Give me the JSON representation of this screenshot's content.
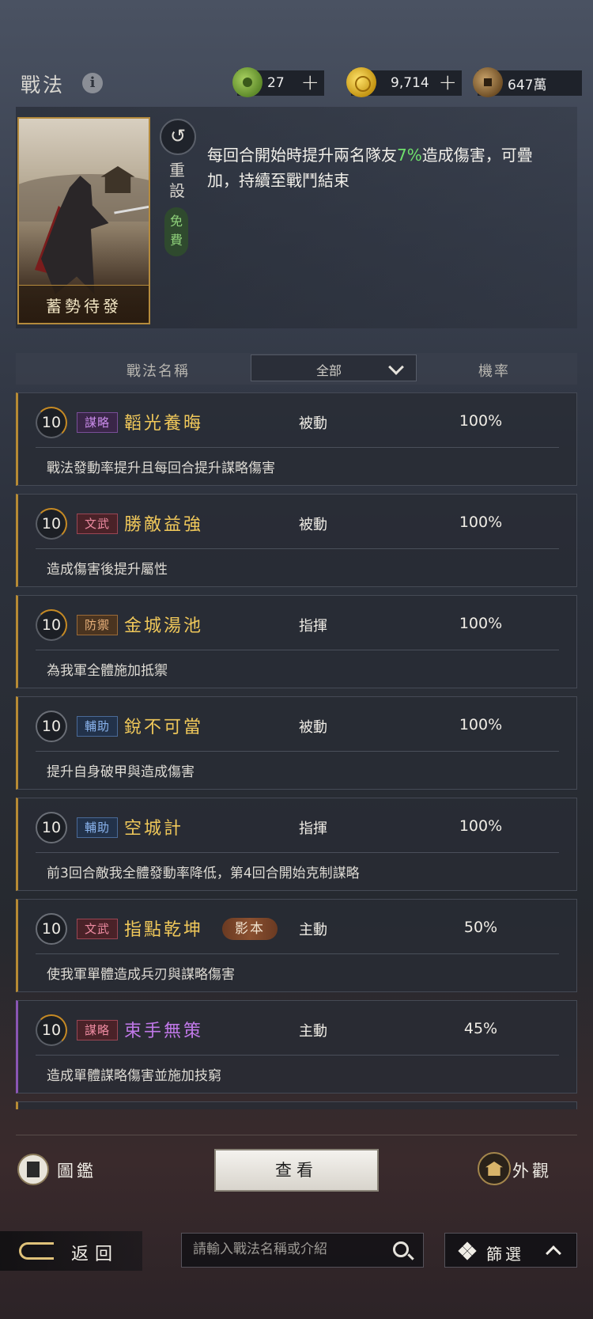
{
  "header": {
    "title": "戰法",
    "info_icon": "info-icon",
    "resources": [
      {
        "icon": "jade-icon",
        "value": "27",
        "has_plus": true
      },
      {
        "icon": "gold-ingot-icon",
        "value": "9,714",
        "has_plus": true
      },
      {
        "icon": "copper-coin-icon",
        "value": "647萬",
        "has_plus": false
      }
    ],
    "plus_glyph": "+"
  },
  "featured": {
    "card_name": "蓄勢待發",
    "reset_label": "重設",
    "free_label": "免費",
    "description_part1": "每回合開始時提升兩名隊友",
    "description_highlight": "7%",
    "description_part2": "造成傷害，可疊加，持續至戰鬥結束",
    "highlight_color": "#6fe06c"
  },
  "columns": {
    "name_header": "戰法名稱",
    "filter_selected": "全部",
    "rate_header": "機率"
  },
  "skills": [
    {
      "level": "10",
      "tag": "謀略",
      "name": "韜光養晦",
      "type": "被動",
      "rate": "100%",
      "desc": "戰法發動率提升且每回合提升謀略傷害"
    },
    {
      "level": "10",
      "tag": "文武",
      "name": "勝敵益強",
      "type": "被動",
      "rate": "100%",
      "desc": "造成傷害後提升屬性"
    },
    {
      "level": "10",
      "tag": "防禦",
      "name": "金城湯池",
      "type": "指揮",
      "rate": "100%",
      "desc": "為我軍全體施加抵禦"
    },
    {
      "level": "10",
      "tag": "輔助",
      "name": "銳不可當",
      "type": "被動",
      "rate": "100%",
      "desc": "提升自身破甲與造成傷害"
    },
    {
      "level": "10",
      "tag": "輔助",
      "name": "空城計",
      "type": "指揮",
      "rate": "100%",
      "desc": "前3回合敵我全體發動率降低，第4回合開始克制謀略"
    },
    {
      "level": "10",
      "tag": "文武",
      "name": "指點乾坤",
      "copy_badge": "影本",
      "type": "主動",
      "rate": "50%",
      "desc": "使我軍單體造成兵刃與謀略傷害"
    },
    {
      "level": "10",
      "tag": "謀略",
      "name": "束手無策",
      "type": "主動",
      "rate": "45%",
      "desc": "造成單體謀略傷害並施加技窮"
    }
  ],
  "actions": {
    "album_label": "圖鑑",
    "view_label": "查看",
    "skin_label": "外觀"
  },
  "footer": {
    "back_label": "返回",
    "search_placeholder": "請輸入戰法名稱或介紹",
    "filter_label": "篩選"
  }
}
